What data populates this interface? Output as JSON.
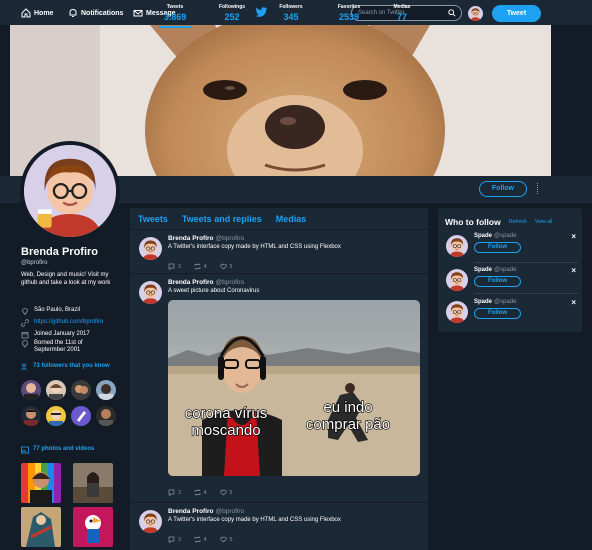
{
  "nav": {
    "home": "Home",
    "notifications": "Notifications",
    "messages": "Message",
    "search_placeholder": "Search on Twitter",
    "tweet_button": "Tweet"
  },
  "stats": [
    {
      "label": "Tweets",
      "value": "3.869"
    },
    {
      "label": "Followings",
      "value": "252"
    },
    {
      "label": "Followers",
      "value": "345"
    },
    {
      "label": "Favorites",
      "value": "2539"
    },
    {
      "label": "Medias",
      "value": "77"
    }
  ],
  "follow_button": "Follow",
  "profile": {
    "name": "Brenda Profiro",
    "handle": "@bprofiro",
    "bio": "Web, Design and music! Visit my github and take a look at my work",
    "location": "São Paulo, Brazil",
    "link": "https://github.com/bprofiro",
    "joined": "Joined January 2017",
    "born": "Borned the 11st of Septermber 2001",
    "followers_known": "73 followers that you know",
    "photos_videos": "77 photos and videos"
  },
  "tabs": [
    "Tweets",
    "Tweets and replies",
    "Medias"
  ],
  "tweets": [
    {
      "name": "Brenda Profiro",
      "handle": "@bprofiro",
      "text": "A Twitter's interface copy made by HTML and CSS using Flexbox",
      "replies": "3",
      "retweets": "4",
      "likes": "5"
    },
    {
      "name": "Brenda Profiro",
      "handle": "@bprofiro",
      "text": "A sweet picture about Coronavirus",
      "replies": "3",
      "retweets": "4",
      "likes": "5",
      "meme": {
        "left": "corona vírus moscando",
        "right": "eu indo comprar pão"
      }
    },
    {
      "name": "Brenda Profiro",
      "handle": "@bprofiro",
      "text": "A Twitter's interface copy made by HTML and CSS using Flexbox",
      "replies": "3",
      "retweets": "4",
      "likes": "5"
    }
  ],
  "who_to_follow": {
    "title": "Who to follow",
    "refresh": "Refresh",
    "view_all": "View all",
    "suggestions": [
      {
        "name": "Spade",
        "handle": "@spade",
        "button": "Follow"
      },
      {
        "name": "Spade",
        "handle": "@spade",
        "button": "Follow"
      },
      {
        "name": "Spade",
        "handle": "@spade",
        "button": "Follow"
      }
    ]
  },
  "colors": {
    "accent": "#1da1f2",
    "background": "#131c26",
    "panel": "#1b2836"
  }
}
